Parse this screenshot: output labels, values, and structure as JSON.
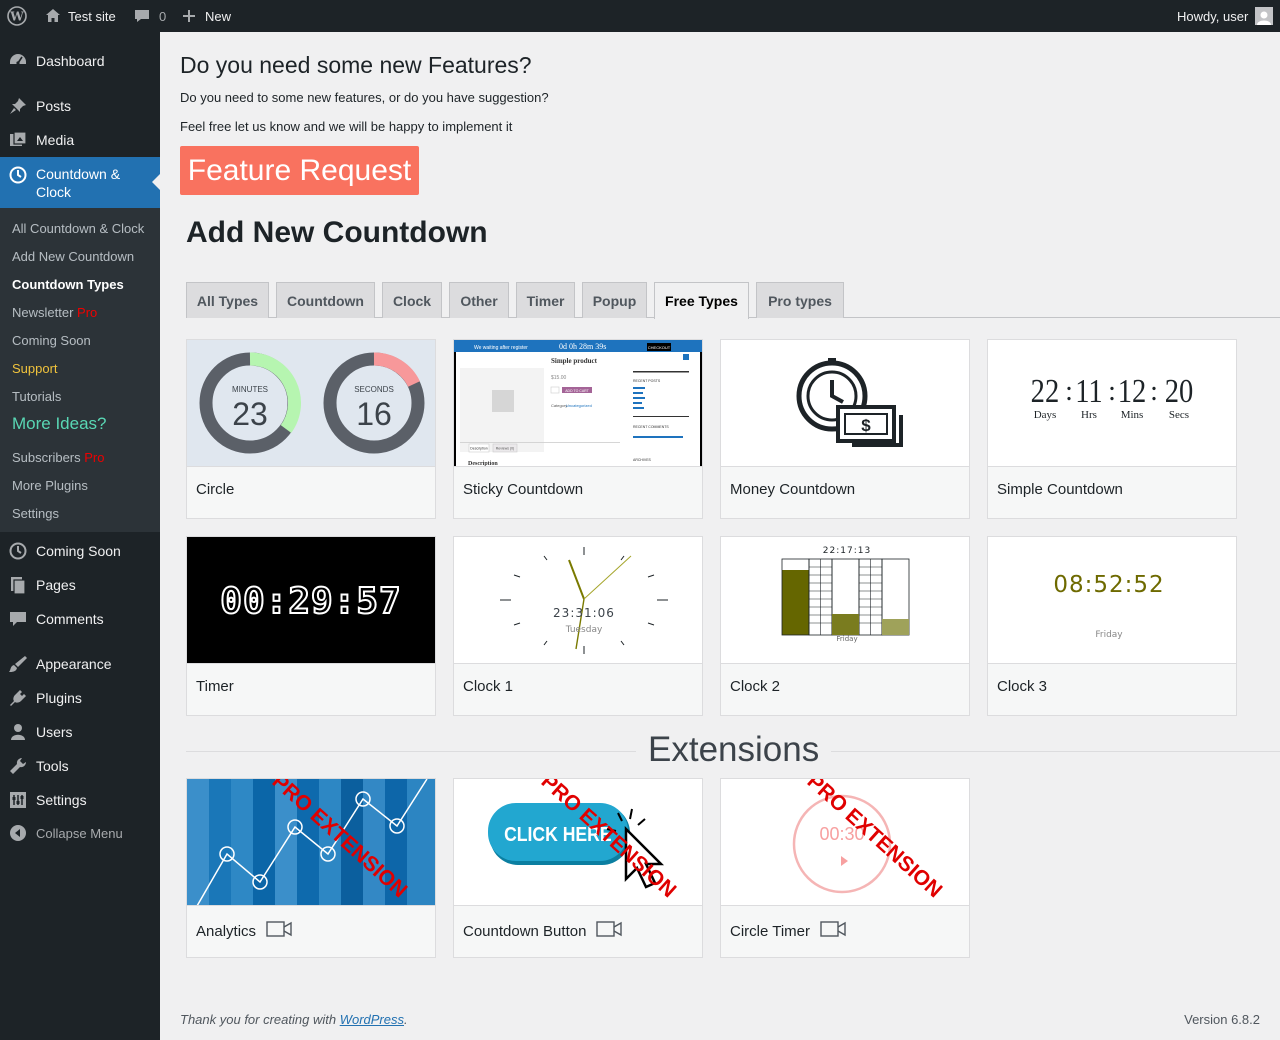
{
  "admin_bar": {
    "site_name": "Test site",
    "comments_count": "0",
    "new_label": "New",
    "howdy": "Howdy, user"
  },
  "sidebar": {
    "dashboard": "Dashboard",
    "posts": "Posts",
    "media": "Media",
    "countdown_clock": "Countdown & Clock",
    "submenu": {
      "all": "All Countdown & Clock",
      "add_new": "Add New Countdown",
      "types": "Countdown Types",
      "newsletter": "Newsletter",
      "newsletter_pro": "Pro",
      "coming_soon": "Coming Soon",
      "support": "Support",
      "tutorials": "Tutorials",
      "more_ideas": "More Ideas?",
      "subscribers": "Subscribers",
      "subscribers_pro": "Pro",
      "more_plugins": "More Plugins",
      "settings": "Settings"
    },
    "coming_soon": "Coming Soon",
    "pages": "Pages",
    "comments": "Comments",
    "appearance": "Appearance",
    "plugins": "Plugins",
    "users": "Users",
    "tools": "Tools",
    "settings": "Settings",
    "collapse": "Collapse Menu"
  },
  "main": {
    "heading": "Do you need some new Features?",
    "para1": "Do you need to some new features, or do you have suggestion?",
    "para2": "Feel free let us know and we will be happy to implement it",
    "feature_button": "Feature Request",
    "add_heading": "Add New Countdown",
    "tabs": [
      "All Types",
      "Countdown",
      "Clock",
      "Other",
      "Timer",
      "Popup",
      "Free Types",
      "Pro types"
    ],
    "active_tab": "Free Types",
    "cards": [
      {
        "title": "Circle",
        "minutes_label": "MINUTES",
        "minutes": "23",
        "seconds_label": "SECONDS",
        "seconds": "16"
      },
      {
        "title": "Sticky Countdown",
        "banner_text": "We waiting after register",
        "counter": "0d 0h 28m 39s",
        "checkout": "CHECKOUT",
        "product": "Simple product",
        "price": "$15.00",
        "add_to_cart": "ADD TO CART",
        "category_label": "Category:",
        "category": "Uncategorized",
        "recent_posts": "RECENT POSTS",
        "recent_comments": "RECENT COMMENTS",
        "archives": "ARCHIVES",
        "tab_description": "Description",
        "tab_reviews": "Reviews (0)",
        "description_heading": "Description"
      },
      {
        "title": "Money Countdown",
        "symbol": "$"
      },
      {
        "title": "Simple Countdown",
        "values": [
          "22",
          "11",
          "12",
          "20"
        ],
        "labels": [
          "Days",
          "Hrs",
          "Mins",
          "Secs"
        ]
      },
      {
        "title": "Timer",
        "display": "00:29:57"
      },
      {
        "title": "Clock 1",
        "time": "23:31:06",
        "day": "Tuesday"
      },
      {
        "title": "Clock 2",
        "time": "22:17:13",
        "day": "Friday"
      },
      {
        "title": "Clock 3",
        "time": "08:52:52",
        "day": "Friday"
      }
    ],
    "extensions_heading": "Extensions",
    "extensions": [
      {
        "title": "Analytics",
        "badge": "PRO EXTENSION"
      },
      {
        "title": "Countdown Button",
        "badge": "PRO EXTENSION",
        "button_text": "CLICK HERE"
      },
      {
        "title": "Circle Timer",
        "badge": "PRO EXTENSION",
        "timer": "00:30"
      }
    ]
  },
  "footer": {
    "thanks_prefix": "Thank you for creating with",
    "wordpress": "WordPress",
    "period": ".",
    "version": "Version 6.8.2"
  },
  "colors": {
    "admin_bg": "#1d2327",
    "active_menu": "#2271b1",
    "feature_button": "#f9725f",
    "support_link": "#f0c33c",
    "more_ideas": "#59d7b4",
    "pro_badge": "#e00000",
    "clock3_text": "#6e6a00"
  }
}
